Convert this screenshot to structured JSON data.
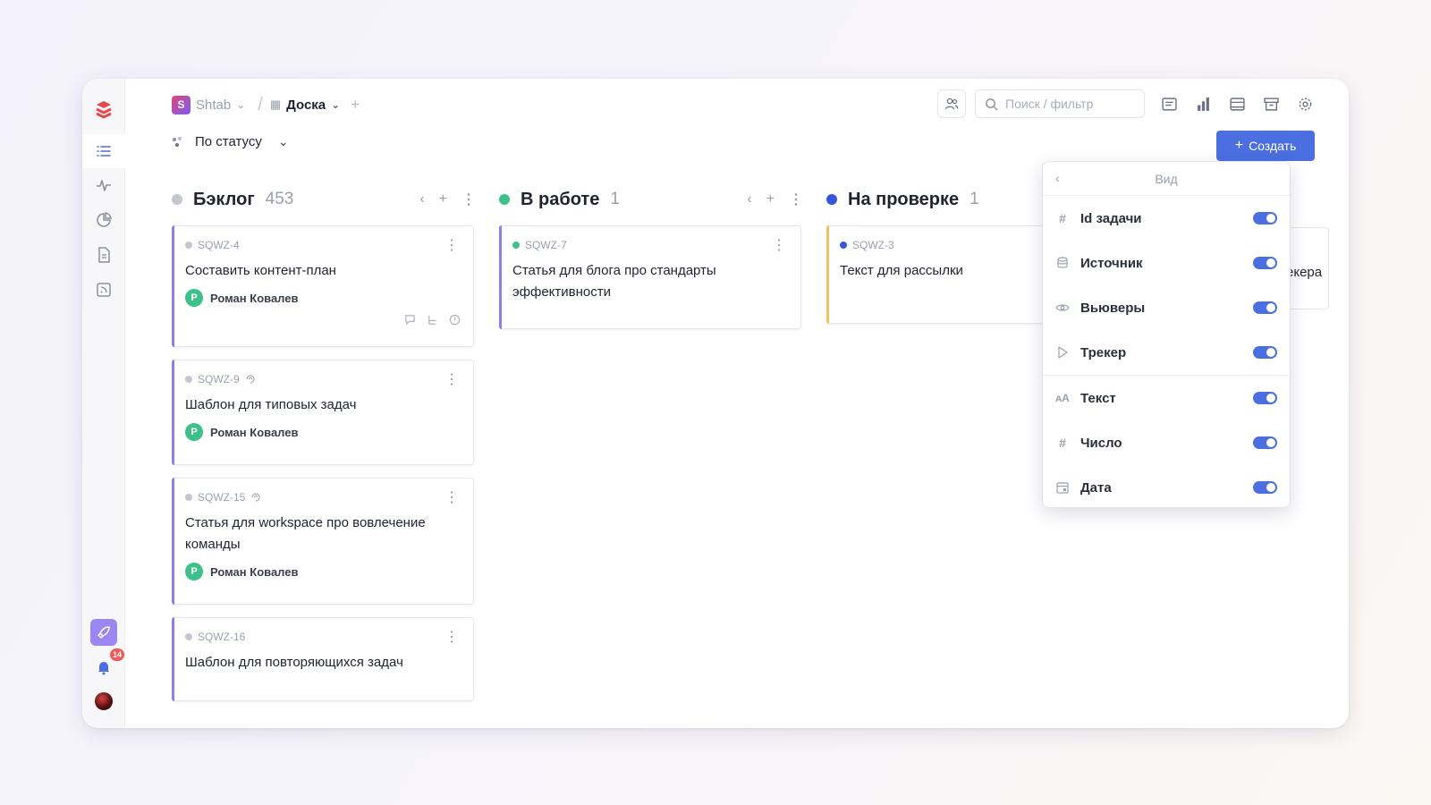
{
  "breadcrumb": {
    "workspace_badge": "S",
    "workspace": "Shtab",
    "board": "Доска"
  },
  "search": {
    "placeholder": "Поиск / фильтр"
  },
  "groupby": {
    "label": "По статусу"
  },
  "create_button": {
    "label": "Создать"
  },
  "notifications": {
    "count": "14"
  },
  "columns": [
    {
      "title": "Бэклог",
      "count": "453",
      "color": "#c4c7cf",
      "cards": [
        {
          "id": "SQWZ-4",
          "title": "Составить контент-план",
          "assignee": "Роман Ковалев",
          "avatar": "Р"
        },
        {
          "id": "SQWZ-9",
          "title": "Шаблон для типовых задач",
          "assignee": "Роман Ковалев",
          "avatar": "Р"
        },
        {
          "id": "SQWZ-15",
          "title": "Статья для workspace про вовлечение команды",
          "assignee": "Роман Ковалев",
          "avatar": "Р"
        },
        {
          "id": "SQWZ-16",
          "title": "Шаблон для повторяющихся задач"
        }
      ]
    },
    {
      "title": "В работе",
      "count": "1",
      "color": "#3dc08a",
      "cards": [
        {
          "id": "SQWZ-7",
          "title": "Статья для блога про стандарты эффективности"
        }
      ]
    },
    {
      "title": "На проверке",
      "count": "1",
      "color": "#3656e0",
      "cards": [
        {
          "id": "SQWZ-3",
          "title": "Текст для рассылки"
        }
      ]
    }
  ],
  "peek_text": "екера",
  "view_menu": {
    "title": "Вид",
    "items": [
      {
        "label": "Id задачи",
        "icon": "hash-icon",
        "enabled": true
      },
      {
        "label": "Источник",
        "icon": "database-icon",
        "enabled": true
      },
      {
        "label": "Вьюверы",
        "icon": "eye-icon",
        "enabled": true
      },
      {
        "label": "Трекер",
        "icon": "play-icon",
        "enabled": true
      },
      {
        "label": "Текст",
        "icon": "text-size-icon",
        "enabled": true
      },
      {
        "label": "Число",
        "icon": "hash-icon",
        "enabled": true
      },
      {
        "label": "Дата",
        "icon": "calendar-icon",
        "enabled": true
      }
    ]
  }
}
